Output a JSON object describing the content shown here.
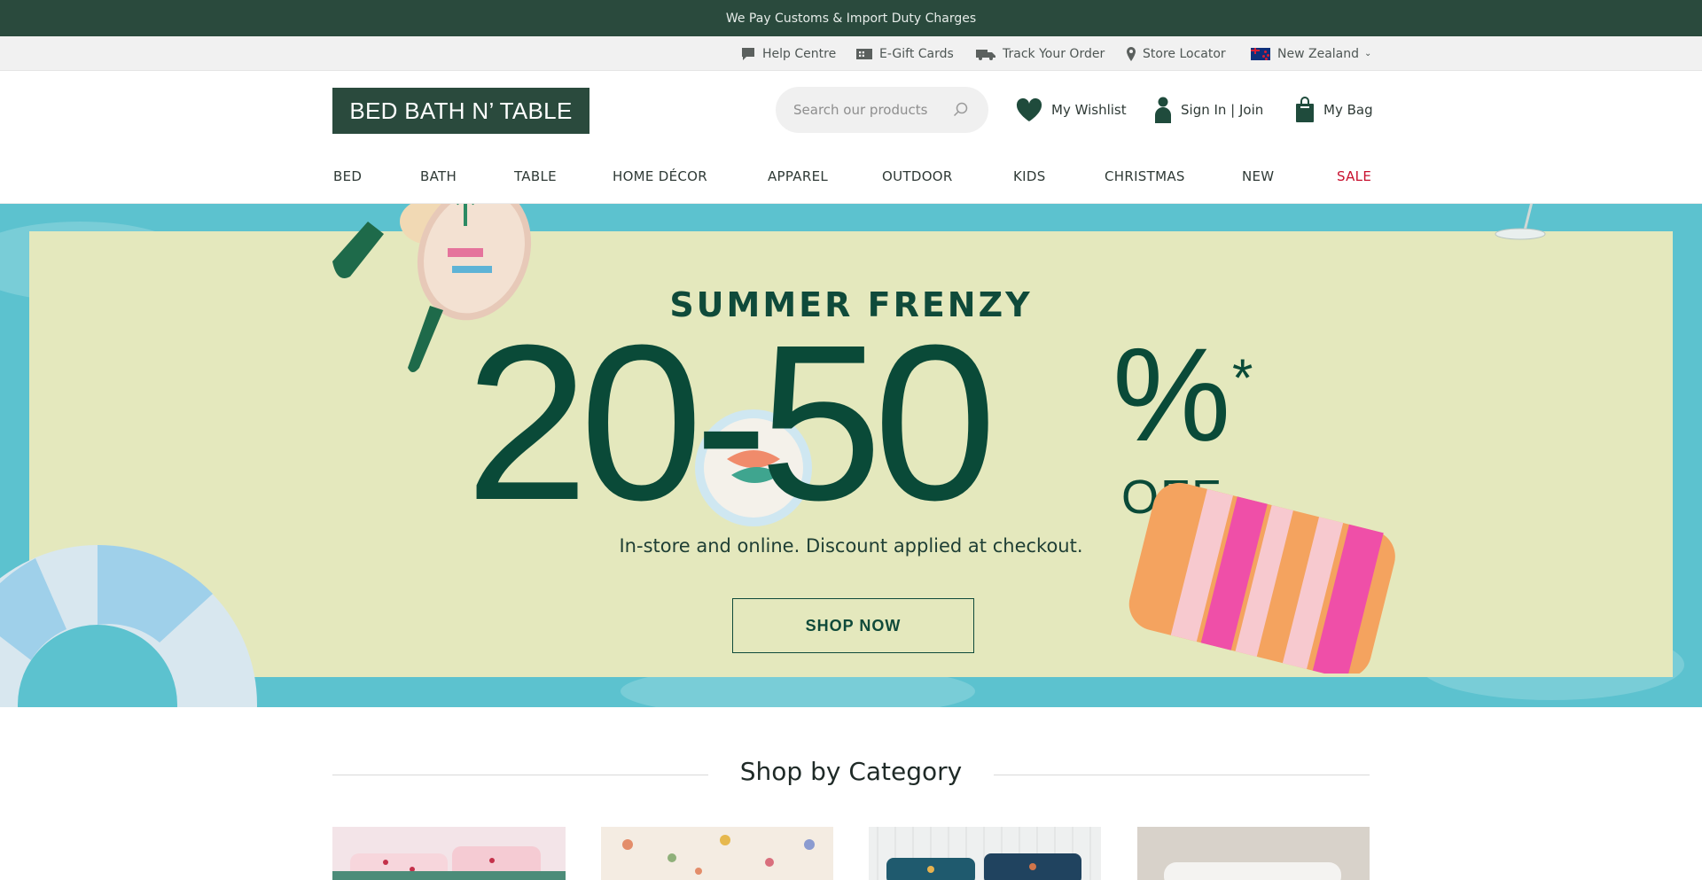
{
  "announcement": {
    "text": "We Pay Customs & Import Duty Charges"
  },
  "utility": {
    "help": "Help Centre",
    "gift": "E-Gift Cards",
    "track": "Track Your Order",
    "store": "Store Locator",
    "region": "New Zealand"
  },
  "header": {
    "logo": "BED BATH N’ TABLE",
    "search_placeholder": "Search our products",
    "wishlist": "My Wishlist",
    "signin": "Sign In | Join",
    "bag": "My Bag"
  },
  "nav": {
    "items": [
      "BED",
      "BATH",
      "TABLE",
      "HOME DÉCOR",
      "APPAREL",
      "OUTDOOR",
      "KIDS",
      "CHRISTMAS",
      "NEW",
      "SALE"
    ]
  },
  "hero": {
    "subtitle": "SUMMER FRENZY",
    "headline": "20-50",
    "percent": "%",
    "asterisk": "*",
    "off": "OFF",
    "note": "In-store and online. Discount applied at checkout.",
    "cta": "SHOP NOW"
  },
  "categories": {
    "title": "Shop by Category"
  },
  "colors": {
    "brand_green": "#2a4a3d",
    "hero_text": "#0a4a38",
    "hero_panel": "#e4e8bd",
    "pool": "#5cc2cf",
    "sale_red": "#c8102e"
  },
  "icons": [
    "chat-icon",
    "gift-card-icon",
    "truck-icon",
    "location-pin-icon",
    "nz-flag-icon",
    "chevron-down-icon",
    "search-icon",
    "heart-icon",
    "user-icon",
    "bag-icon"
  ]
}
